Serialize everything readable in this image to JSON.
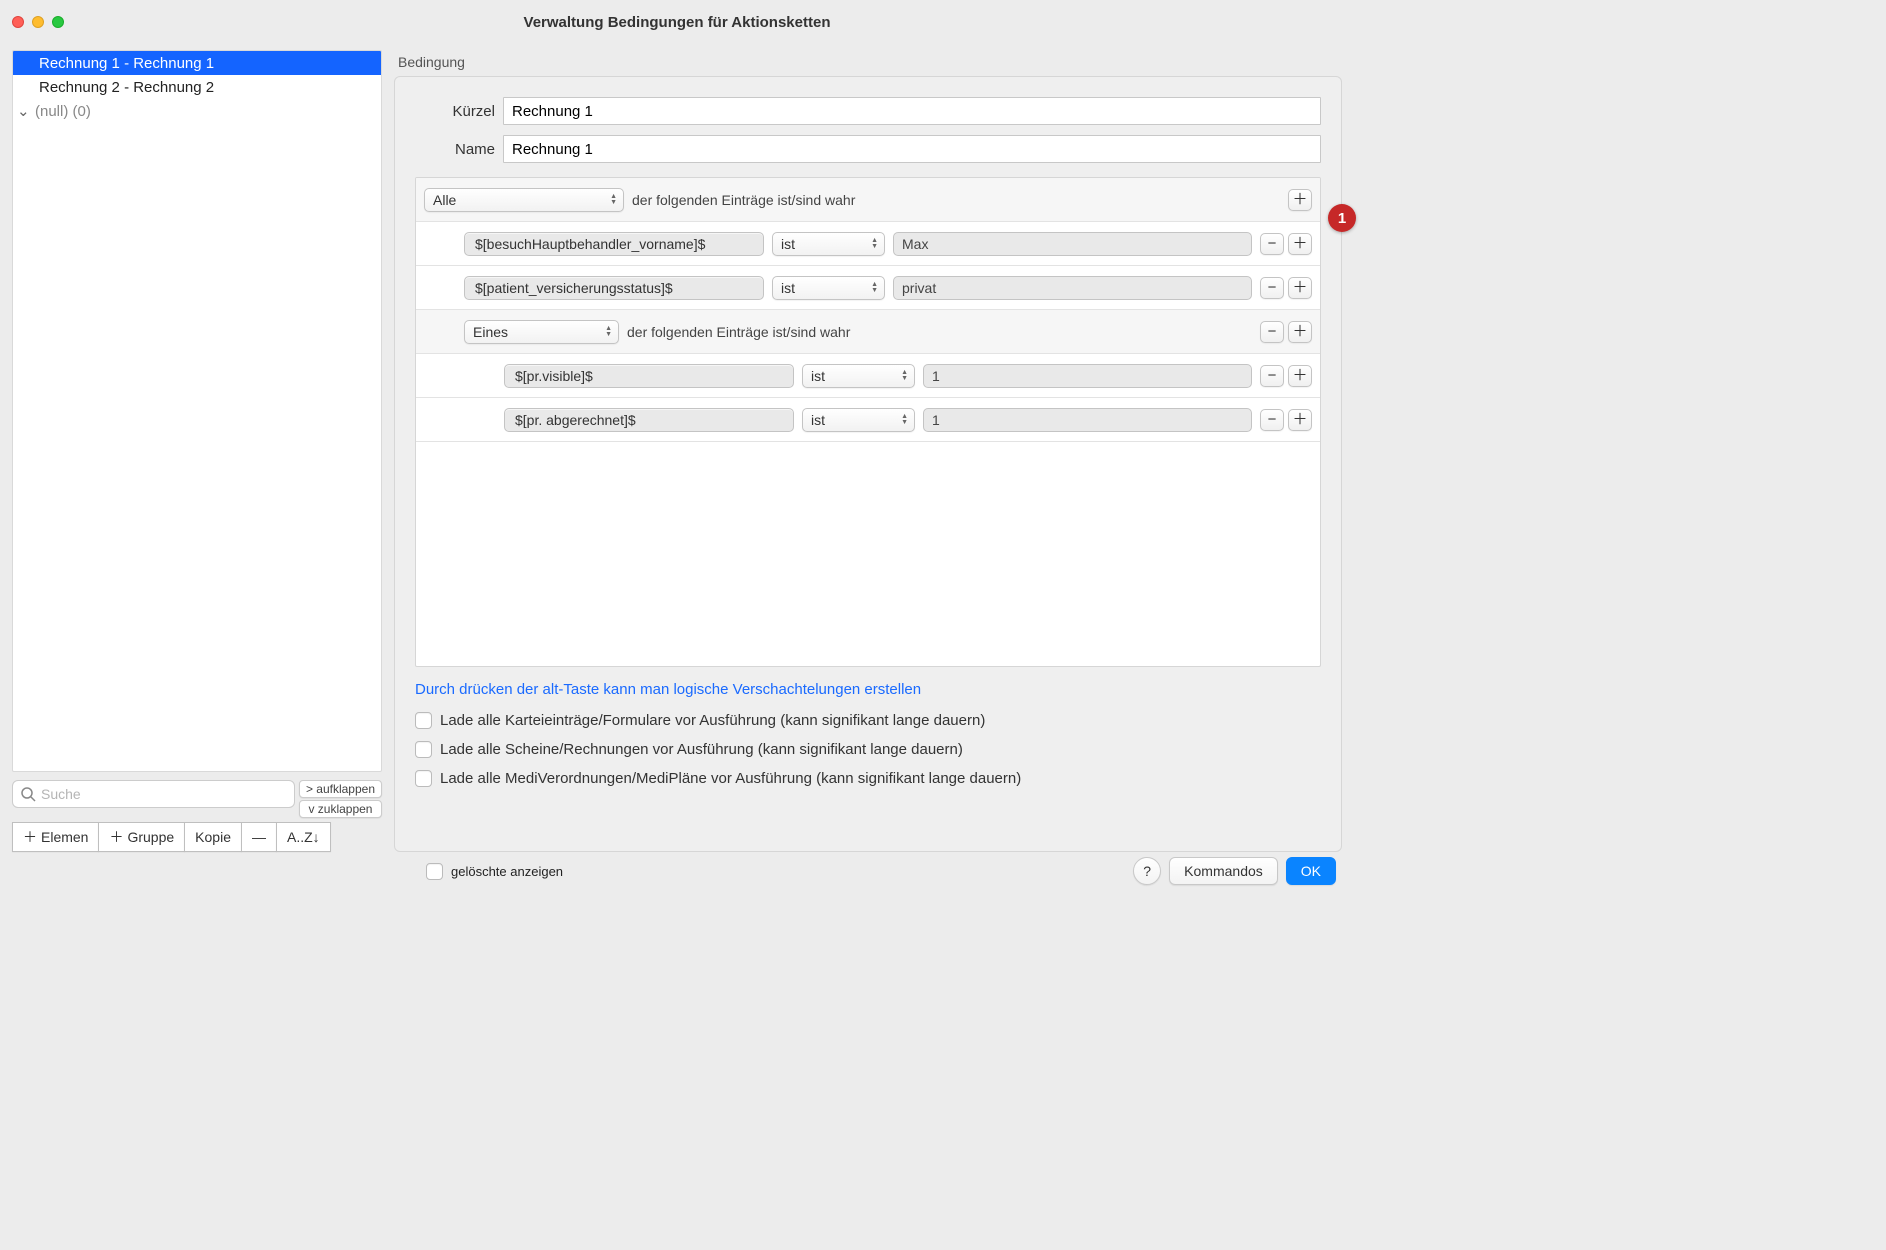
{
  "window": {
    "title": "Verwaltung Bedingungen für Aktionsketten"
  },
  "sidebar": {
    "items": [
      {
        "label": "Rechnung 1 - Rechnung 1",
        "selected": true
      },
      {
        "label": "Rechnung 2 - Rechnung 2",
        "selected": false
      },
      {
        "label": "(null)  (0)",
        "selected": false,
        "group": true
      }
    ],
    "search_placeholder": "Suche",
    "expand_label": "> aufklappen",
    "collapse_label": "v  zuklappen",
    "toolbar": {
      "add_element": "Elemen",
      "add_group": "Gruppe",
      "copy": "Kopie",
      "remove": "—",
      "sort": "A..Z↓"
    }
  },
  "panel": {
    "section_label": "Bedingung",
    "kuerzel_label": "Kürzel",
    "kuerzel_value": "Rechnung 1",
    "name_label": "Name",
    "name_value": "Rechnung 1",
    "badge": "1",
    "group1": {
      "quantifier": "Alle",
      "suffix": "der folgenden Einträge ist/sind wahr"
    },
    "cond1": {
      "field": "$[besuchHauptbehandler_vorname]$",
      "op": "ist",
      "value": "Max"
    },
    "cond2": {
      "field": "$[patient_versicherungsstatus]$",
      "op": "ist",
      "value": "privat"
    },
    "group2": {
      "quantifier": "Eines",
      "suffix": "der folgenden Einträge ist/sind wahr"
    },
    "cond3": {
      "field": "$[pr.visible]$",
      "op": "ist",
      "value": "1"
    },
    "cond4": {
      "field": "$[pr. abgerechnet]$",
      "op": "ist",
      "value": "1"
    },
    "hint": "Durch drücken der alt-Taste kann man logische Verschachtelungen erstellen",
    "chk1": "Lade alle Karteieinträge/Formulare vor Ausführung (kann signifikant lange dauern)",
    "chk2": "Lade alle Scheine/Rechnungen vor Ausführung (kann signifikant lange dauern)",
    "chk3": "Lade alle MediVerordnungen/MediPläne vor Ausführung (kann signifikant lange dauern)"
  },
  "footer": {
    "show_deleted": "gelöschte anzeigen",
    "help": "?",
    "commands": "Kommandos",
    "ok": "OK"
  }
}
